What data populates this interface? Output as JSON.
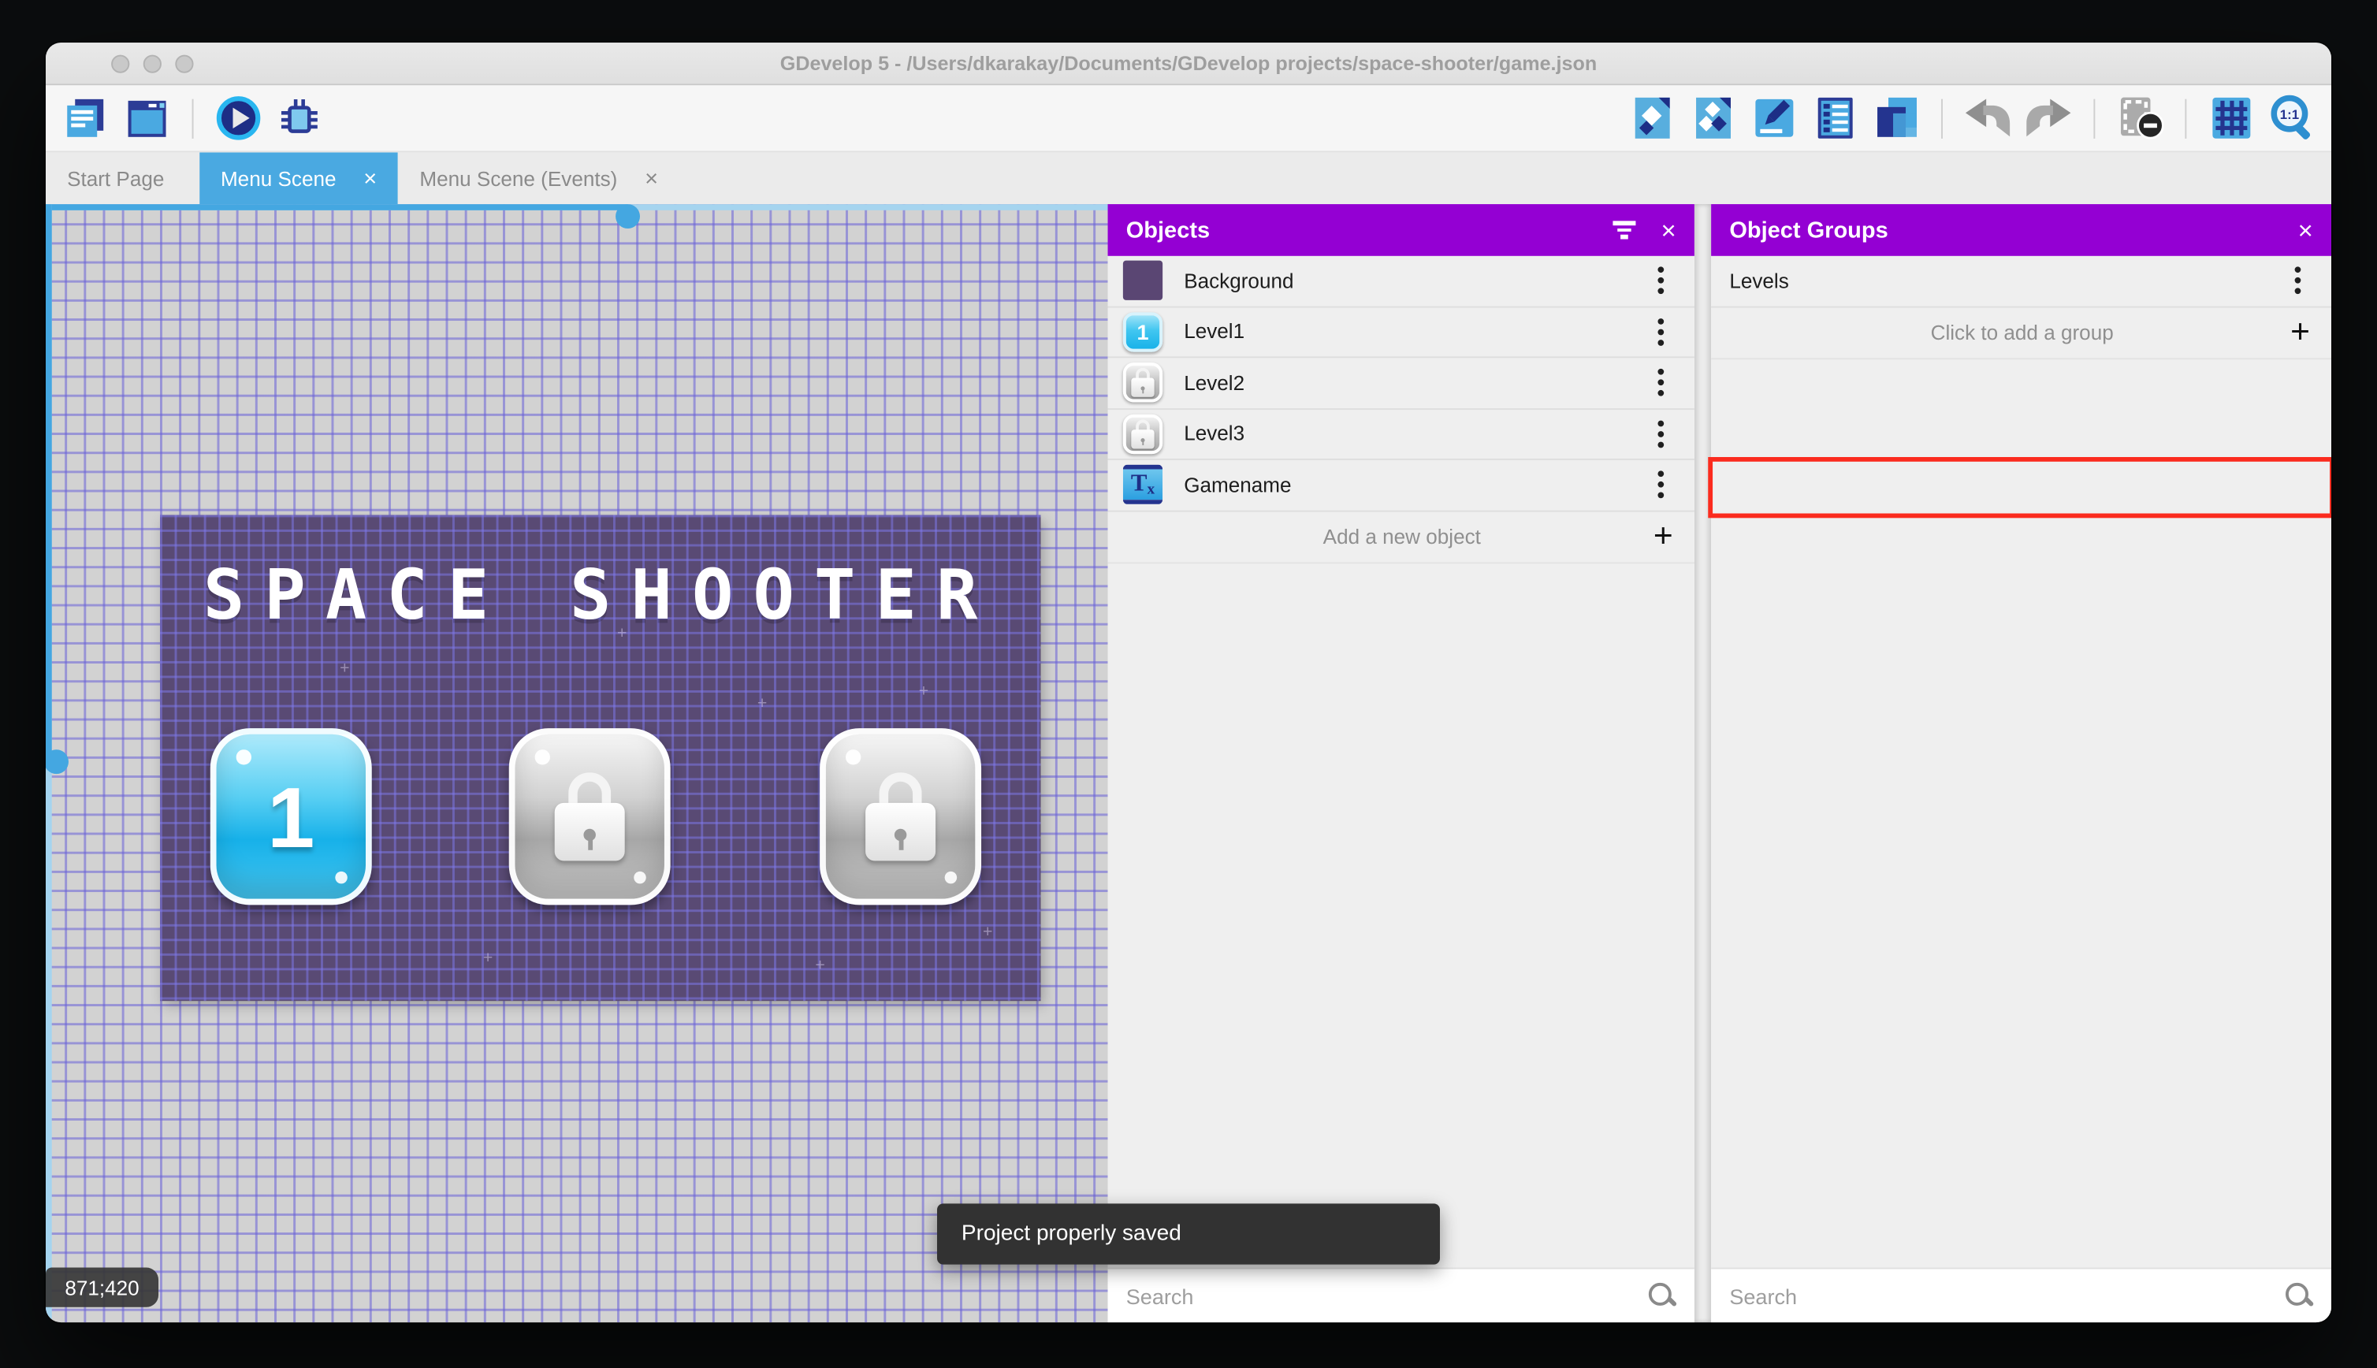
{
  "window": {
    "title": "GDevelop 5 - /Users/dkarakay/Documents/GDevelop projects/space-shooter/game.json",
    "traffic_lights": [
      "close",
      "minimize",
      "zoom"
    ]
  },
  "toolbar": {
    "left_icons": [
      "project-manager-icon",
      "scene-editor-icon",
      "preview-play-icon",
      "debug-icon"
    ],
    "right_icons": [
      "objects-editor-icon",
      "object-groups-icon",
      "properties-icon",
      "instances-list-icon",
      "layers-icon",
      "undo-icon",
      "redo-icon",
      "remove-instances-icon",
      "grid-icon",
      "zoom-original-icon"
    ]
  },
  "tabs": [
    {
      "label": "Start Page",
      "active": false,
      "closable": false
    },
    {
      "label": "Menu Scene",
      "active": true,
      "closable": true
    },
    {
      "label": "Menu Scene (Events)",
      "active": false,
      "closable": true
    }
  ],
  "canvas": {
    "scene_title": "SPACE SHOOTER",
    "level_buttons": [
      {
        "label": "1",
        "locked": false
      },
      {
        "label": "",
        "locked": true
      },
      {
        "label": "",
        "locked": true
      }
    ],
    "cursor_coordinates": "871;420",
    "toast": "Project properly saved"
  },
  "objects_panel": {
    "title": "Objects",
    "items": [
      {
        "name": "Background",
        "thumb": "purple-square"
      },
      {
        "name": "Level1",
        "thumb": "blue-button-1",
        "thumb_label": "1"
      },
      {
        "name": "Level2",
        "thumb": "gray-lock-button"
      },
      {
        "name": "Level3",
        "thumb": "gray-lock-button"
      },
      {
        "name": "Gamename",
        "thumb": "text-object"
      }
    ],
    "add_label": "Add a new object",
    "search_placeholder": "Search"
  },
  "object_groups_panel": {
    "title": "Object Groups",
    "groups": [
      {
        "name": "Levels",
        "highlighted": true
      }
    ],
    "add_label": "Click to add a group",
    "search_placeholder": "Search"
  },
  "icons": {
    "close_glyph": "×",
    "plus_glyph": "+"
  },
  "colors": {
    "header_purple": "#9400d3",
    "accent_blue": "#4aa9e1",
    "annotation_red": "#fb2b1e",
    "scene_purple": "#594a74"
  }
}
